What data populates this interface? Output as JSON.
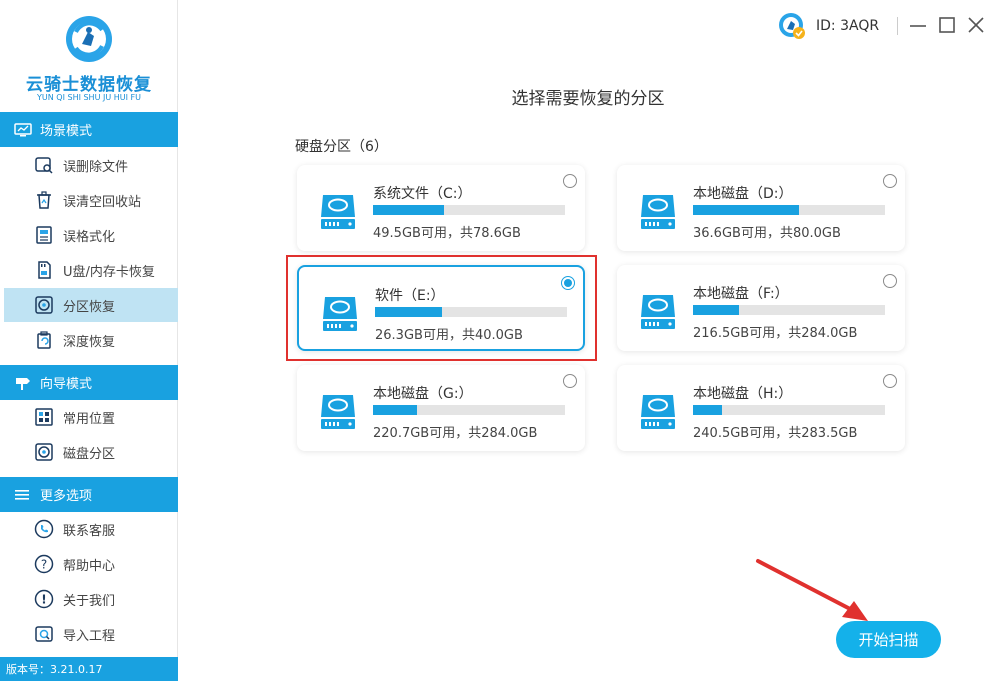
{
  "app": {
    "logo_title": "云骑士数据恢复",
    "logo_subtitle": "YUN QI SHI SHU JU HUI FU",
    "version": "版本号：3.21.0.17"
  },
  "topbar": {
    "id_text": "ID: 3AQR"
  },
  "sidebar": {
    "sections": [
      {
        "title": "场景模式",
        "items": [
          {
            "label": "误删除文件",
            "active": false
          },
          {
            "label": "误清空回收站",
            "active": false
          },
          {
            "label": "误格式化",
            "active": false
          },
          {
            "label": "U盘/内存卡恢复",
            "active": false
          },
          {
            "label": "分区恢复",
            "active": true
          },
          {
            "label": "深度恢复",
            "active": false
          }
        ]
      },
      {
        "title": "向导模式",
        "items": [
          {
            "label": "常用位置",
            "active": false
          },
          {
            "label": "磁盘分区",
            "active": false
          }
        ]
      },
      {
        "title": "更多选项",
        "items": [
          {
            "label": "联系客服",
            "active": false
          },
          {
            "label": "帮助中心",
            "active": false
          },
          {
            "label": "关于我们",
            "active": false
          },
          {
            "label": "导入工程",
            "active": false
          }
        ]
      }
    ]
  },
  "main": {
    "title": "选择需要恢复的分区",
    "section_label": "硬盘分区（6）",
    "partitions": [
      {
        "name": "系统文件（C:）",
        "info": "49.5GB可用，共78.6GB",
        "used_fraction": 0.37,
        "selected": false
      },
      {
        "name": "本地磁盘（D:）",
        "info": "36.6GB可用，共80.0GB",
        "used_fraction": 0.55,
        "selected": false
      },
      {
        "name": "软件（E:）",
        "info": "26.3GB可用，共40.0GB",
        "used_fraction": 0.35,
        "selected": true
      },
      {
        "name": "本地磁盘（F:）",
        "info": "216.5GB可用，共284.0GB",
        "used_fraction": 0.24,
        "selected": false
      },
      {
        "name": "本地磁盘（G:）",
        "info": "220.7GB可用，共284.0GB",
        "used_fraction": 0.23,
        "selected": false
      },
      {
        "name": "本地磁盘（H:）",
        "info": "240.5GB可用，共283.5GB",
        "used_fraction": 0.15,
        "selected": false
      }
    ],
    "scan_button": "开始扫描"
  },
  "colors": {
    "accent": "#19a1e0",
    "highlight": "#e0312e",
    "active_nav": "#bfe3f3"
  }
}
